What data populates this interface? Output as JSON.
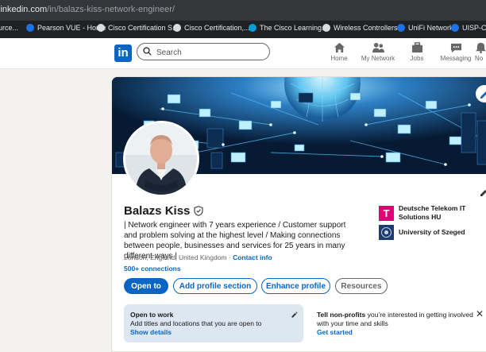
{
  "browser": {
    "url_host": "linkedin.com",
    "url_path": "/in/balazs-kiss-network-engineer/",
    "bookmarks": [
      {
        "label": "urce...",
        "color": "#5f6368"
      },
      {
        "label": "Pearson VUE - Home",
        "color": "#1a73e8"
      },
      {
        "label": "Cisco Certification S...",
        "color": "#049fd9"
      },
      {
        "label": "Cisco Certification,...",
        "color": "#049fd9"
      },
      {
        "label": "The Cisco Learning...",
        "color": "#049fd9"
      },
      {
        "label": "Wireless Controllers...",
        "color": "#049fd9"
      },
      {
        "label": "UniFi Network",
        "color": "#1a73e8"
      },
      {
        "label": "UISP-Con",
        "color": "#1a73e8"
      }
    ]
  },
  "nav": {
    "logo_text": "in",
    "search_placeholder": "Search",
    "items": [
      {
        "label": "Home",
        "icon": "home-icon"
      },
      {
        "label": "My Network",
        "icon": "people-icon"
      },
      {
        "label": "Jobs",
        "icon": "briefcase-icon"
      },
      {
        "label": "Messaging",
        "icon": "message-icon"
      },
      {
        "label": "No",
        "icon": "bell-icon"
      }
    ]
  },
  "profile": {
    "name": "Balazs Kiss",
    "headline": "| Network engineer with 7 years experience / Customer support and problem solving at the highest level / Making connections between people, businesses and services for 25 years in many different ways |",
    "location": "London, England, United Kingdom",
    "location_sep": "·",
    "contact_info": "Contact info",
    "connections": "500+ connections",
    "companies": [
      {
        "name": "Deutsche Telekom IT Solutions HU",
        "logo_text": "T",
        "logo_color": "#e20074"
      },
      {
        "name": "University of Szeged",
        "logo_text": "",
        "logo_color": "#1e3a6e"
      }
    ],
    "buttons": {
      "open_to": "Open to",
      "add_section": "Add profile section",
      "enhance": "Enhance profile",
      "resources": "Resources"
    },
    "open_to_work": {
      "title": "Open to work",
      "description": "Add titles and locations that you are open to",
      "link": "Show details"
    },
    "nonprofits": {
      "title": "Tell non-profits",
      "text": " you’re interested in getting involved with your time and skills",
      "link": "Get started",
      "close": "✕"
    }
  },
  "colors": {
    "brand": "#0a66c2",
    "page_bg": "#f3f2ef",
    "otw_bg": "#dde7f1"
  }
}
